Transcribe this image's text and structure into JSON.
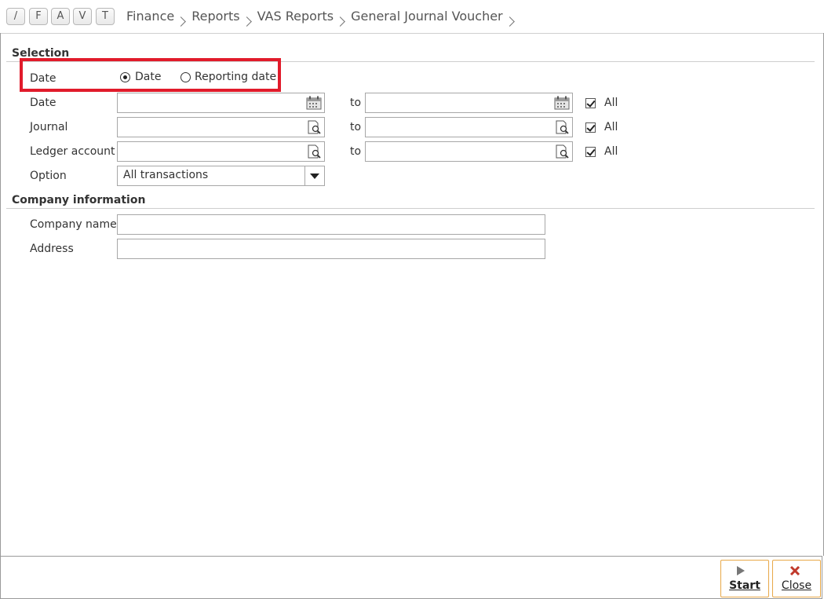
{
  "quick_buttons": [
    "/",
    "F",
    "A",
    "V",
    "T"
  ],
  "breadcrumbs": [
    "Finance",
    "Reports",
    "VAS Reports",
    "General Journal Voucher"
  ],
  "selection": {
    "title": "Selection",
    "date_type": {
      "label": "Date",
      "options": [
        {
          "label": "Date",
          "selected": true
        },
        {
          "label": "Reporting date",
          "selected": false
        }
      ]
    },
    "rows": [
      {
        "label": "Date",
        "from": "",
        "to_label": "to",
        "to": "",
        "all_label": "All",
        "all_checked": true,
        "icon": "calendar-icon"
      },
      {
        "label": "Journal",
        "from": "",
        "to_label": "to",
        "to": "",
        "all_label": "All",
        "all_checked": true,
        "icon": "lookup-icon"
      },
      {
        "label": "Ledger account",
        "from": "",
        "to_label": "to",
        "to": "",
        "all_label": "All",
        "all_checked": true,
        "icon": "lookup-icon"
      }
    ],
    "option": {
      "label": "Option",
      "value": "All transactions"
    }
  },
  "company": {
    "title": "Company information",
    "name": {
      "label": "Company name",
      "value": ""
    },
    "address": {
      "label": "Address",
      "value": ""
    }
  },
  "footer": {
    "start_label": "Start",
    "close_label": "Close"
  },
  "colors": {
    "highlight": "#e11b2b",
    "button_border": "#e8a848",
    "close_icon": "#c0392b"
  }
}
